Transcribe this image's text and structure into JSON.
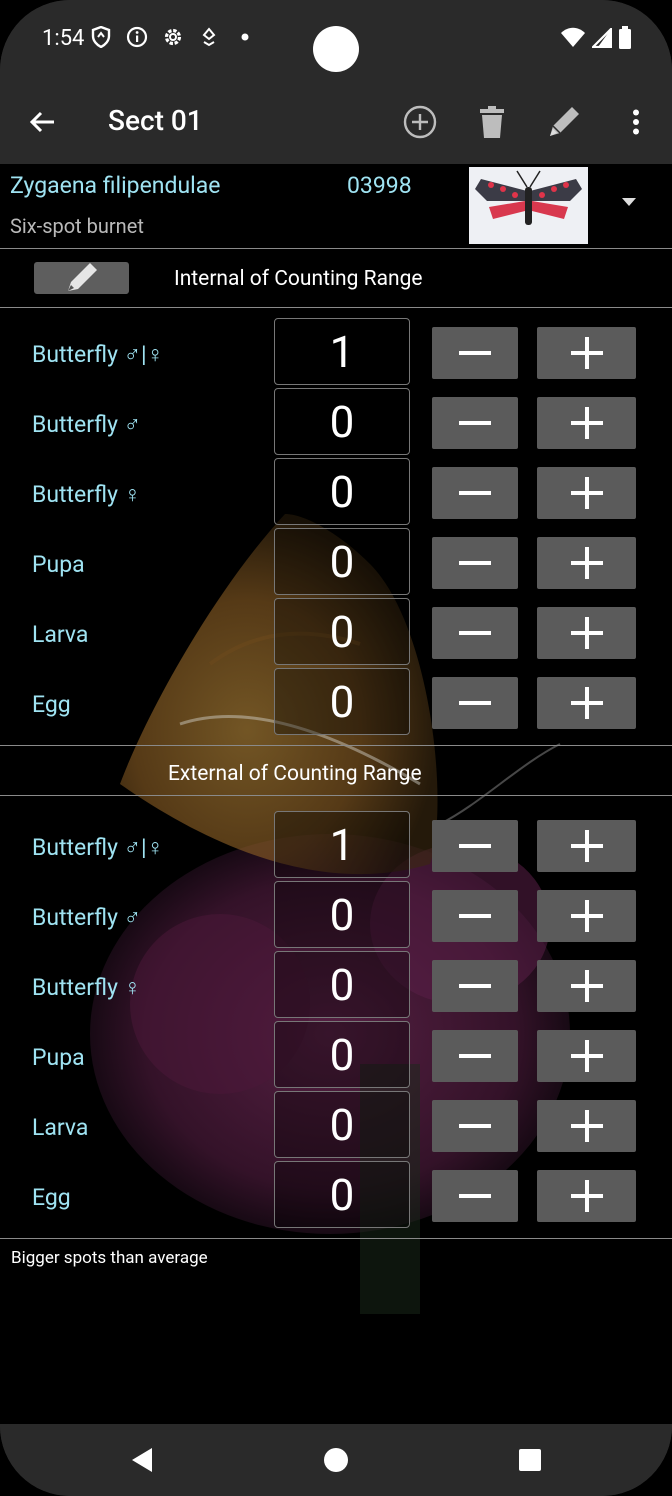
{
  "status_bar": {
    "time": "1:54",
    "icons": [
      "shield-icon",
      "info-icon",
      "settings-icon",
      "location-icon",
      "dot-icon"
    ],
    "right_icons": [
      "wifi-icon",
      "signal-icon",
      "battery-icon"
    ]
  },
  "app_bar": {
    "title": "Sect 01",
    "actions": [
      "add-circle-icon",
      "delete-icon",
      "edit-icon",
      "more-icon"
    ]
  },
  "species": {
    "scientific_name": "Zygaena filipendulae",
    "code": "03998",
    "common_name": "Six-spot burnet"
  },
  "internal_section": {
    "title": "Internal of Counting Range",
    "rows": [
      {
        "label": "Butterfly ♂|♀",
        "count": "1"
      },
      {
        "label": "Butterfly ♂",
        "count": "0"
      },
      {
        "label": "Butterfly ♀",
        "count": "0"
      },
      {
        "label": "Pupa",
        "count": "0"
      },
      {
        "label": "Larva",
        "count": "0"
      },
      {
        "label": "Egg",
        "count": "0"
      }
    ]
  },
  "external_section": {
    "title": "External of Counting Range",
    "rows": [
      {
        "label": "Butterfly ♂|♀",
        "count": "1"
      },
      {
        "label": "Butterfly ♂",
        "count": "0"
      },
      {
        "label": "Butterfly ♀",
        "count": "0"
      },
      {
        "label": "Pupa",
        "count": "0"
      },
      {
        "label": "Larva",
        "count": "0"
      },
      {
        "label": "Egg",
        "count": "0"
      }
    ]
  },
  "note": "Bigger spots than average",
  "nav_bar": [
    "back-triangle-icon",
    "home-circle-icon",
    "recents-square-icon"
  ],
  "colors": {
    "label": "#9fe3f2",
    "button": "#5b5b5b",
    "bar": "#2a2a2a"
  }
}
